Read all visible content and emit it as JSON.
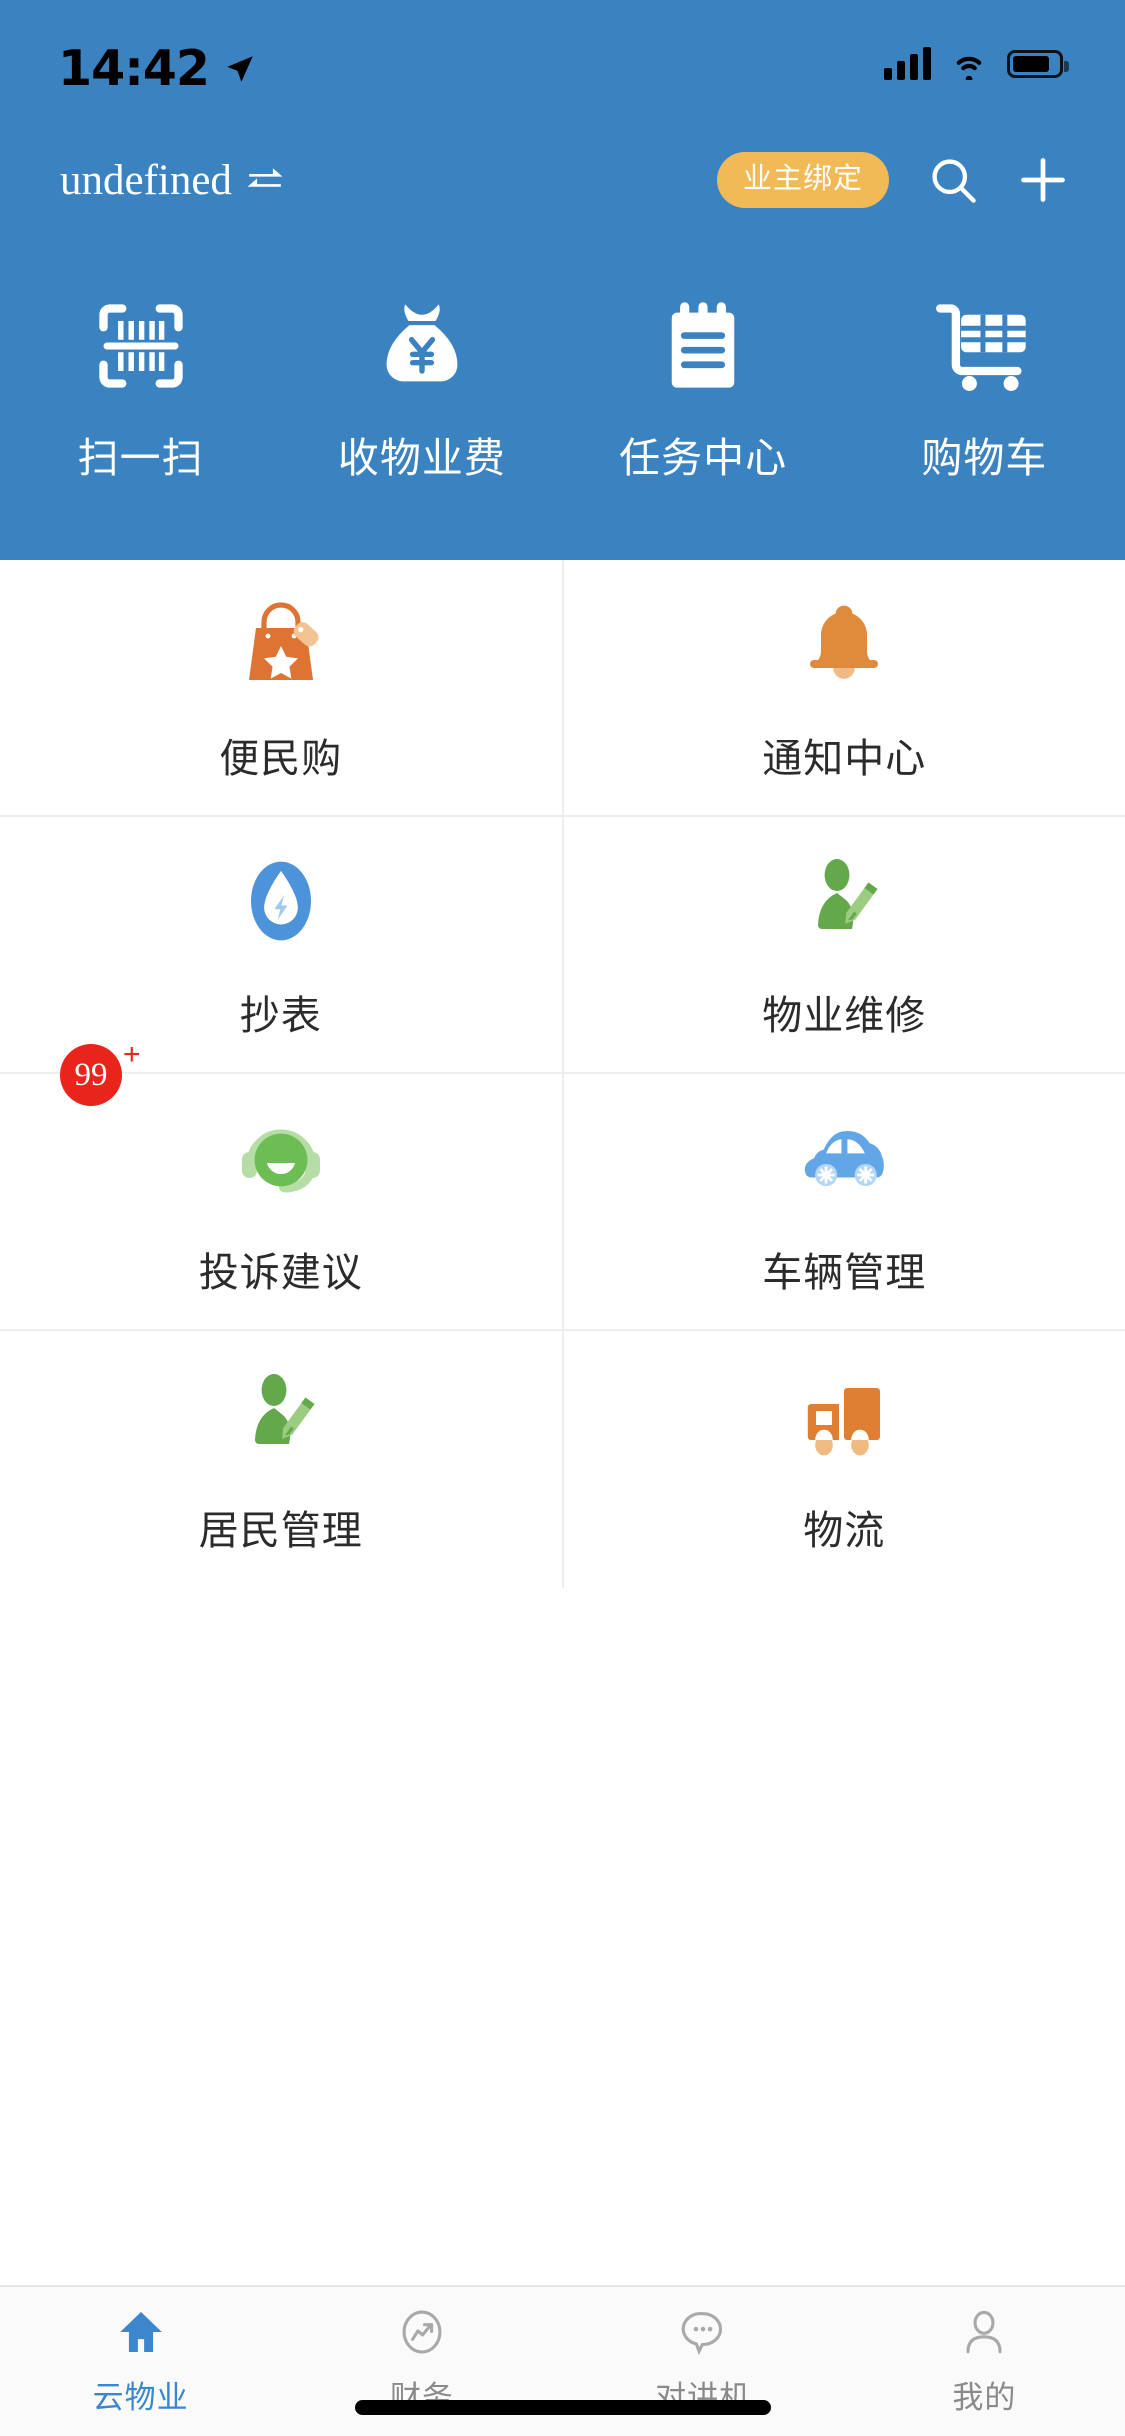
{
  "status_bar": {
    "time": "14:42",
    "location_icon": "location-arrow-icon",
    "signal_icon": "cellular-signal-icon",
    "wifi_icon": "wifi-icon",
    "battery_icon": "battery-icon"
  },
  "nav_bar": {
    "title": "undefined",
    "swap_icon": "swap-arrows-icon",
    "bind_button_label": "业主绑定",
    "search_icon": "search-icon",
    "add_icon": "plus-icon"
  },
  "quick_actions": [
    {
      "label": "扫一扫",
      "icon": "barcode-scan-icon"
    },
    {
      "label": "收物业费",
      "icon": "money-bag-icon"
    },
    {
      "label": "任务中心",
      "icon": "clipboard-list-icon"
    },
    {
      "label": "购物车",
      "icon": "shopping-cart-icon"
    }
  ],
  "grid": {
    "rows": [
      [
        {
          "label": "便民购",
          "icon": "shopping-bag-star-icon",
          "color": "#de7333",
          "badge": null
        },
        {
          "label": "通知中心",
          "icon": "bell-icon",
          "color": "#e08a3c",
          "badge": null
        }
      ],
      [
        {
          "label": "抄表",
          "icon": "water-meter-icon",
          "color": "#4d93d9",
          "badge": null
        },
        {
          "label": "物业维修",
          "icon": "person-pencil-icon",
          "color": "#63a84a",
          "badge": null
        }
      ],
      [
        {
          "label": "投诉建议",
          "icon": "headset-support-icon",
          "color": "#6bbd54",
          "badge": {
            "count": "99",
            "plus": "+"
          }
        },
        {
          "label": "车辆管理",
          "icon": "car-icon",
          "color": "#62a6e8",
          "badge": null
        }
      ],
      [
        {
          "label": "居民管理",
          "icon": "person-pencil-icon",
          "color": "#63a84a",
          "badge": null
        },
        {
          "label": "物流",
          "icon": "delivery-truck-icon",
          "color": "#de7f33",
          "badge": null
        }
      ]
    ]
  },
  "tab_bar": {
    "tabs": [
      {
        "label": "云物业",
        "icon": "home-icon",
        "active": true
      },
      {
        "label": "财务",
        "icon": "chart-circle-icon",
        "active": false
      },
      {
        "label": "对讲机",
        "icon": "chat-bubble-icon",
        "active": false
      },
      {
        "label": "我的",
        "icon": "person-icon",
        "active": false
      }
    ]
  },
  "colors": {
    "header_blue": "#3b83c0",
    "accent_orange": "#f2b957",
    "active_tab_blue": "#3b86cc",
    "badge_red": "#e8241b"
  }
}
